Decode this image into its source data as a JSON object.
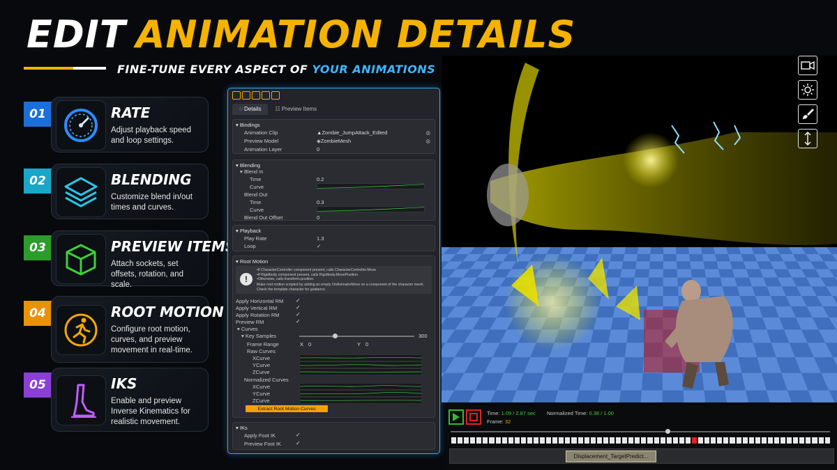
{
  "header": {
    "title_part1": "EDIT",
    "title_part2": "ANIMATION DETAILS",
    "subtitle_part1": "FINE-TUNE EVERY ASPECT OF",
    "subtitle_part2": "YOUR ANIMATIONS"
  },
  "features": [
    {
      "num": "01",
      "title": "RATE",
      "desc": "Adjust playback speed and loop settings."
    },
    {
      "num": "02",
      "title": "BLENDING",
      "desc": "Customize blend in/out times and curves."
    },
    {
      "num": "03",
      "title": "PREVIEW ITEMS",
      "desc": "Attach sockets, set offsets, rotation, and scale."
    },
    {
      "num": "04",
      "title": "ROOT MOTION",
      "desc": "Configure root motion, curves, and preview movement in real-time."
    },
    {
      "num": "05",
      "title": "IKS",
      "desc": "Enable and preview Inverse Kinematics for realistic movement."
    }
  ],
  "inspector": {
    "tabs": [
      "Details",
      "Preview Items"
    ],
    "bindings": {
      "header": "Bindings",
      "animation_clip_label": "Animation Clip",
      "animation_clip_value": "Zombie_JumpAttack_Edited",
      "preview_model_label": "Preview Model",
      "preview_model_value": "ZombieMesh",
      "animation_layer_label": "Animation Layer",
      "animation_layer_value": "0"
    },
    "blending": {
      "header": "Blending",
      "blend_in_label": "Blend In",
      "blend_in_time_label": "Time",
      "blend_in_time_value": "0.2",
      "blend_in_curve_label": "Curve",
      "blend_out_label": "Blend Out",
      "blend_out_time_label": "Time",
      "blend_out_time_value": "0.3",
      "blend_out_curve_label": "Curve",
      "blend_out_offset_label": "Blend Out Offset",
      "blend_out_offset_value": "0"
    },
    "playback": {
      "header": "Playback",
      "play_rate_label": "Play Rate",
      "play_rate_value": "1.3",
      "loop_label": "Loop",
      "loop_checked": true
    },
    "root_motion": {
      "header": "Root Motion",
      "note_line1": "•If CharacterController component present, calls CharacterController.Move",
      "note_line2": "•If Rigidbody component present, calls Rigidbody.MovePosition",
      "note_line3": "•Otherwise, calls transform.position.",
      "note_line4": "Make root motion scripted by adding an empty OnAnimatorMove on a component of the character mesh. Check the template character for guidance.",
      "apply_horizontal_label": "Apply Horizontal RM",
      "apply_vertical_label": "Apply Vertical RM",
      "apply_rotation_label": "Apply Rotation RM",
      "preview_rm_label": "Preview RM",
      "curves_label": "Curves",
      "key_samples_label": "Key Samples",
      "key_samples_value": "300",
      "frame_range_label": "Frame Range",
      "frame_range_x_label": "X",
      "frame_range_x_value": "0",
      "frame_range_y_label": "Y",
      "frame_range_y_value": "0",
      "raw_curves_label": "Raw Curves",
      "normalized_curves_label": "Normalized Curves",
      "xcurve_label": "XCurve",
      "ycurve_label": "YCurve",
      "zcurve_label": "ZCurve",
      "extract_button": "Extract Root Motion Curves"
    },
    "iks": {
      "header": "IKs",
      "apply_foot_ik_label": "Apply Foot IK",
      "preview_foot_ik_label": "Preview Foot IK"
    },
    "checkmark": "✓"
  },
  "timeline": {
    "time_label": "Time:",
    "time_value": "1.09 / 2.87 sec",
    "normalized_label": "Normalized Time:",
    "normalized_value": "0.38 / 1.00",
    "frame_label": "Frame:",
    "frame_value": "32",
    "clip_name": "Displacement_TargetPredict..."
  },
  "colors": {
    "accent_yellow": "#f5b300",
    "accent_blue": "#3fb6ff",
    "panel_border": "#3aa6e8",
    "play_green": "#2fbd36",
    "stop_red": "#e02222"
  },
  "viewport_tools": [
    "camera-icon",
    "sun-icon",
    "brush-icon",
    "vertical-arrows-icon"
  ]
}
